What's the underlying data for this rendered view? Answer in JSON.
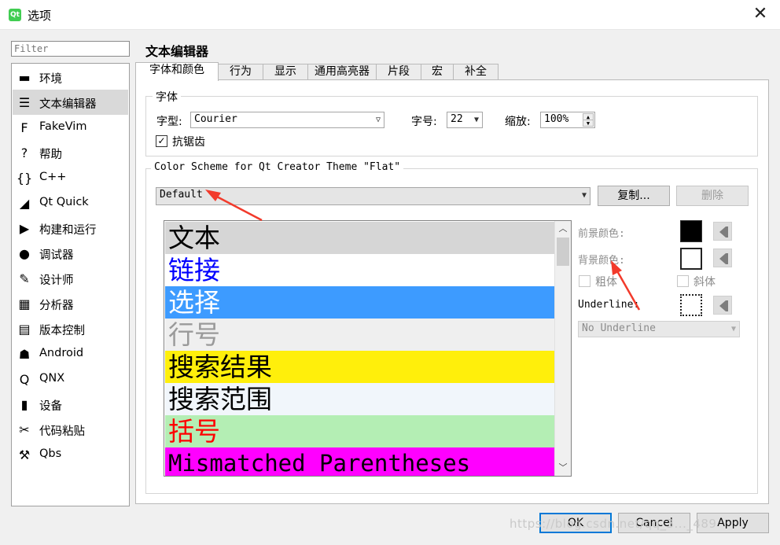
{
  "window": {
    "title": "选项",
    "app_icon": "qt-logo-icon"
  },
  "sidebar": {
    "filter_placeholder": "Filter",
    "items": [
      {
        "label": "环境",
        "icon": "monitor-icon"
      },
      {
        "label": "文本编辑器",
        "icon": "text-editor-icon",
        "selected": true
      },
      {
        "label": "FakeVim",
        "icon": "fakevim-icon"
      },
      {
        "label": "帮助",
        "icon": "help-icon"
      },
      {
        "label": "C++",
        "icon": "braces-icon"
      },
      {
        "label": "Qt Quick",
        "icon": "qt-quick-icon"
      },
      {
        "label": "构建和运行",
        "icon": "build-run-icon"
      },
      {
        "label": "调试器",
        "icon": "debugger-icon"
      },
      {
        "label": "设计师",
        "icon": "designer-icon"
      },
      {
        "label": "分析器",
        "icon": "analyzer-icon"
      },
      {
        "label": "版本控制",
        "icon": "version-control-icon"
      },
      {
        "label": "Android",
        "icon": "android-icon"
      },
      {
        "label": "QNX",
        "icon": "qnx-icon"
      },
      {
        "label": "设备",
        "icon": "device-icon"
      },
      {
        "label": "代码粘贴",
        "icon": "code-paste-icon"
      },
      {
        "label": "Qbs",
        "icon": "hammer-icon"
      }
    ]
  },
  "main": {
    "page_title": "文本编辑器",
    "tabs": [
      "字体和颜色",
      "行为",
      "显示",
      "通用高亮器",
      "片段",
      "宏",
      "补全"
    ],
    "font_group": {
      "title": "字体",
      "family_label": "字型:",
      "family_value": "Courier",
      "size_label": "字号:",
      "size_value": "22",
      "zoom_label": "缩放:",
      "zoom_value": "100%",
      "antialias_label": "抗锯齿",
      "antialias_checked": true
    },
    "scheme_group": {
      "title": "Color Scheme for Qt Creator Theme \"Flat\"",
      "scheme_value": "Default",
      "copy_button": "复制...",
      "delete_button": "删除"
    },
    "scheme_items": [
      {
        "label": "文本",
        "fg": "#000000",
        "bg": "#d6d6d6"
      },
      {
        "label": "链接",
        "fg": "#0000ff",
        "bg": "#ffffff"
      },
      {
        "label": "选择",
        "fg": "#ffffff",
        "bg": "#3d9bff"
      },
      {
        "label": "行号",
        "fg": "#9a9a9a",
        "bg": "#efefef"
      },
      {
        "label": "搜索结果",
        "fg": "#000000",
        "bg": "#ffef0b"
      },
      {
        "label": "搜索范围",
        "fg": "#000000",
        "bg": "#f1f6fb"
      },
      {
        "label": "括号",
        "fg": "#ff0000",
        "bg": "#b4eeb4"
      },
      {
        "label": "Mismatched Parentheses",
        "fg": "#000000",
        "bg": "#ff00ff"
      }
    ],
    "properties": {
      "foreground_label": "前景颜色:",
      "foreground_color": "#000000",
      "background_label": "背景颜色:",
      "background_color": "#ffffff",
      "bold_label": "粗体",
      "italic_label": "斜体",
      "underline_label": "Underline:",
      "underline_style": "No Underline"
    }
  },
  "footer": {
    "ok": "OK",
    "cancel": "Cancel",
    "apply": "Apply"
  },
  "watermark": "https://blog.csdn.net/qq_3..._489"
}
